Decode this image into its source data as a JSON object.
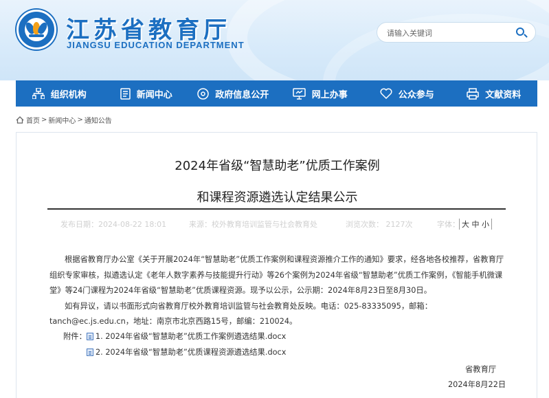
{
  "header": {
    "title": "江苏省教育厅",
    "subtitle": "JIANGSU EDUCATION DEPARTMENT",
    "search_placeholder": "请输入关键词"
  },
  "nav": {
    "items": [
      {
        "label": "组织机构",
        "icon": "org-chart-icon"
      },
      {
        "label": "新闻中心",
        "icon": "document-icon"
      },
      {
        "label": "政府信息公开",
        "icon": "disc-icon"
      },
      {
        "label": "网上办事",
        "icon": "monitor-icon"
      },
      {
        "label": "公众参与",
        "icon": "heart-icon"
      },
      {
        "label": "文献资料",
        "icon": "printer-icon"
      }
    ]
  },
  "breadcrumb": {
    "home": "首页",
    "sep1": ">",
    "news": "新闻中心",
    "sep2": ">",
    "current": "通知公告"
  },
  "article": {
    "title_line1": "2024年省级“智慧助老”优质工作案例",
    "title_line2": "和课程资源遴选认定结果公示",
    "meta": {
      "date": "发布日期：2024-08-22 18:01",
      "source": "来源：校外教育培训监管与社会教育处",
      "views": "浏览次数：  2127次",
      "font_label": "字体：",
      "font_sizes": [
        "大",
        "中",
        "小"
      ]
    },
    "paragraph1": "根据省教育厅办公室《关于开展2024年“智慧助老”优质工作案例和课程资源推介工作的通知》要求，经各地各校推荐，省教育厅组织专家审核，拟遴选认定《老年人数字素养与技能提升行动》等26个案例为2024年省级“智慧助老”优质工作案例，《智能手机微课堂》等24门课程为2024年省级“智慧助老”优质课程资源。现予以公示，公示期：2024年8月23日至8月30日。",
    "paragraph2": "如有异议，请以书面形式向省教育厅校外教育培训监管与社会教育处反映。电话：025-83335095，邮箱：tanch@ec.js.edu.cn，地址：南京市北京西路15号，邮编：210024。",
    "attachments_label": "附件：",
    "attachments": [
      "1. 2024年省级“智慧助老”优质工作案例遴选结果.docx",
      "2. 2024年省级“智慧助老”优质课程资源遴选结果.docx"
    ],
    "signature": "省教育厅",
    "sign_date": "2024年8月22日"
  },
  "colors": {
    "brand": "#1c6fc1",
    "header_bg": "#d9ebfa"
  }
}
